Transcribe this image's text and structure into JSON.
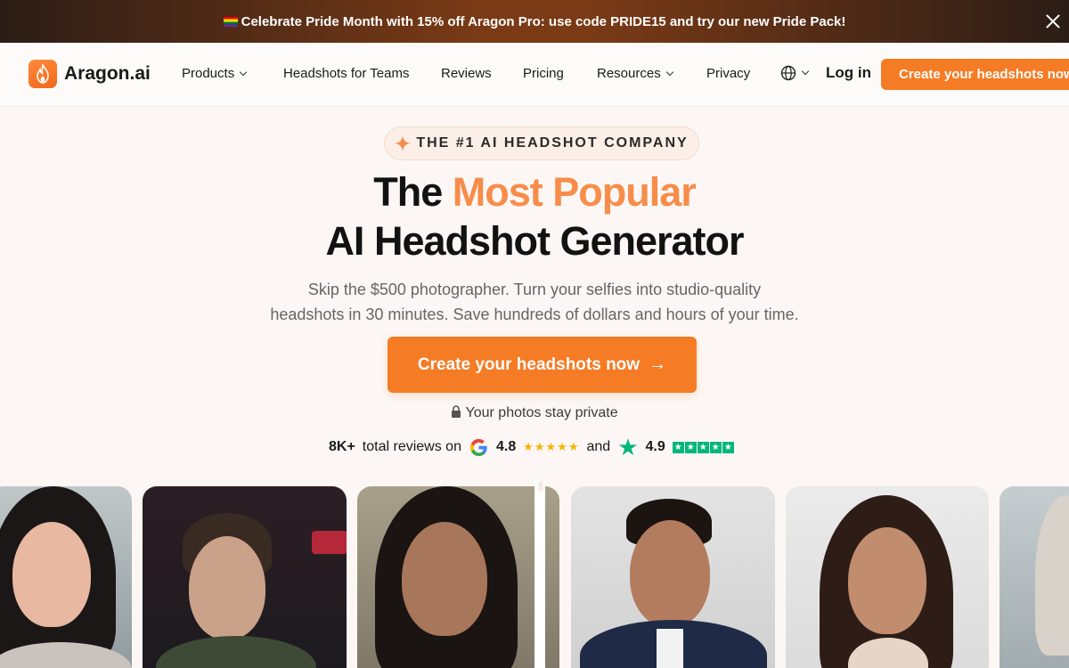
{
  "banner": {
    "text": "Celebrate Pride Month with 15% off Aragon Pro: use code PRIDE15 and try our new Pride Pack!",
    "flag_icon": "rainbow-flag-icon",
    "close_icon": "close-icon"
  },
  "nav": {
    "logo_text": "Aragon.ai",
    "items": [
      {
        "label": "Products",
        "dropdown": true
      },
      {
        "label": "Headshots for Teams",
        "dropdown": false
      },
      {
        "label": "Reviews",
        "dropdown": false
      },
      {
        "label": "Pricing",
        "dropdown": false
      },
      {
        "label": "Resources",
        "dropdown": true
      },
      {
        "label": "Privacy",
        "dropdown": false
      }
    ],
    "language_icon": "globe-icon",
    "login_label": "Log in",
    "cta_label": "Create your headshots now"
  },
  "hero": {
    "eyebrow": "THE #1 AI HEADSHOT COMPANY",
    "title_part1": "The ",
    "title_accent": "Most Popular",
    "title_line2": "AI Headshot Generator",
    "subtitle_line1": "Skip the $500 photographer. Turn your selfies into studio-quality",
    "subtitle_line2": "headshots in 30 minutes. Save hundreds of dollars and hours of your time.",
    "cta_label": "Create your headshots now",
    "privacy_note": "Your photos stay private",
    "reviews": {
      "count": "8K+",
      "label": "total reviews on",
      "google_rating": "4.8",
      "connector": "and",
      "trustpilot_rating": "4.9"
    }
  },
  "colors": {
    "accent": "#f57b25",
    "accent_text": "#f78d4a",
    "trustpilot": "#00b67a",
    "star_yellow": "#f6b400"
  }
}
